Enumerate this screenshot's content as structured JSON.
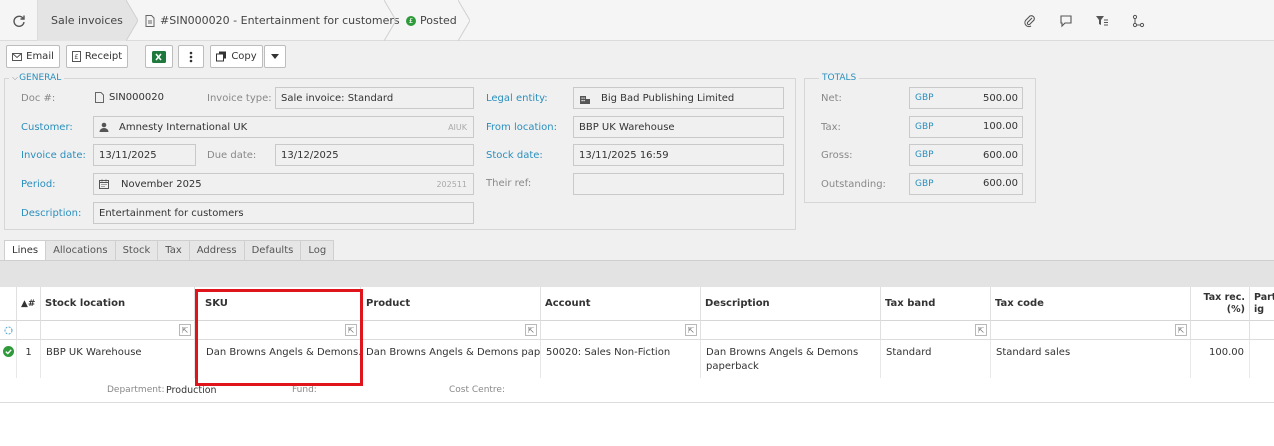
{
  "breadcrumb": {
    "section": "Sale invoices",
    "document": "#SIN000020 - Entertainment for customers",
    "status": "Posted"
  },
  "toolbar": {
    "email": "Email",
    "receipt": "Receipt",
    "copy": "Copy"
  },
  "general": {
    "legend": "GENERAL",
    "doc_label": "Doc #:",
    "doc_value": "SIN000020",
    "invoice_type_label": "Invoice type:",
    "invoice_type_value": "Sale invoice: Standard",
    "legal_entity_label": "Legal entity:",
    "legal_entity_value": "Big Bad Publishing Limited",
    "customer_label": "Customer:",
    "customer_value": "Amnesty International UK",
    "customer_code": "AIUK",
    "from_location_label": "From location:",
    "from_location_value": "BBP UK Warehouse",
    "invoice_date_label": "Invoice date:",
    "invoice_date_value": "13/11/2025",
    "due_date_label": "Due date:",
    "due_date_value": "13/12/2025",
    "stock_date_label": "Stock date:",
    "stock_date_value": "13/11/2025 16:59",
    "period_label": "Period:",
    "period_value": "November 2025",
    "period_code": "202511",
    "their_ref_label": "Their ref:",
    "their_ref_value": "",
    "description_label": "Description:",
    "description_value": "Entertainment for customers"
  },
  "totals": {
    "legend": "TOTALS",
    "rows": [
      {
        "label": "Net:",
        "currency": "GBP",
        "amount": "500.00"
      },
      {
        "label": "Tax:",
        "currency": "GBP",
        "amount": "100.00"
      },
      {
        "label": "Gross:",
        "currency": "GBP",
        "amount": "600.00"
      },
      {
        "label": "Outstanding:",
        "currency": "GBP",
        "amount": "600.00"
      }
    ]
  },
  "tabs": [
    "Lines",
    "Allocations",
    "Stock",
    "Tax",
    "Address",
    "Defaults",
    "Log"
  ],
  "grid": {
    "headers": {
      "sort": "▲#",
      "stock_location": "Stock location",
      "sku": "SKU",
      "product": "Product",
      "account": "Account",
      "description": "Description",
      "tax_band": "Tax band",
      "tax_code": "Tax code",
      "tax_rec": "Tax rec. (%)",
      "part": "Part ig"
    },
    "row": {
      "num": "1",
      "stock_location": "BBP UK Warehouse",
      "sku": "Dan Browns Angels & Demons...",
      "product": "Dan Browns Angels & Demons pap...",
      "account": "50020: Sales Non-Fiction",
      "description": "Dan Browns Angels & Demons paperback",
      "tax_band": "Standard",
      "tax_code": "Standard sales",
      "tax_rec": "100.00"
    },
    "sub": {
      "department_label": "Department:",
      "department_value": "Production",
      "fund_label": "Fund:",
      "cost_centre_label": "Cost Centre:"
    }
  },
  "colors": {
    "accent": "#2a8fbd",
    "posted": "#2e9a3a",
    "highlight": "#e0141b"
  }
}
